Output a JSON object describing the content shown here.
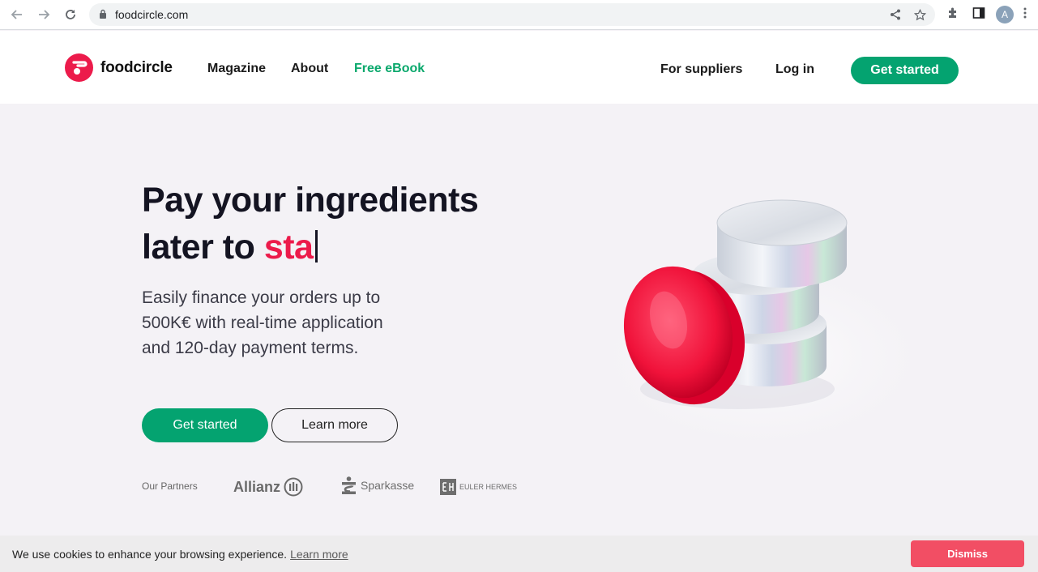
{
  "browser": {
    "url": "foodcircle.com",
    "profile_initial": "A"
  },
  "header": {
    "logo_text": "foodcircle",
    "nav": [
      {
        "label": "Magazine"
      },
      {
        "label": "About"
      },
      {
        "label": "Free eBook"
      }
    ],
    "right_links": [
      {
        "label": "For suppliers"
      },
      {
        "label": "Log in"
      }
    ],
    "cta_label": "Get started"
  },
  "hero": {
    "title_line1": "Pay your ingredients",
    "title_line2_static": "later to ",
    "title_line2_typed": "sta",
    "subtitle": "Easily finance your orders up to 500K€ with real-time application and 120-day payment terms.",
    "primary_button": "Get started",
    "secondary_button": "Learn more"
  },
  "partners": {
    "label": "Our Partners",
    "items": [
      {
        "name": "Allianz"
      },
      {
        "name": "Sparkasse"
      },
      {
        "name": "EULER HERMES"
      }
    ]
  },
  "cookie_banner": {
    "text": "We use cookies to enhance your browsing experience.",
    "link": "Learn more",
    "dismiss": "Dismiss"
  },
  "colors": {
    "brand_red": "#ec1b4b",
    "brand_green": "#04a370",
    "dismiss": "#f24e64"
  }
}
